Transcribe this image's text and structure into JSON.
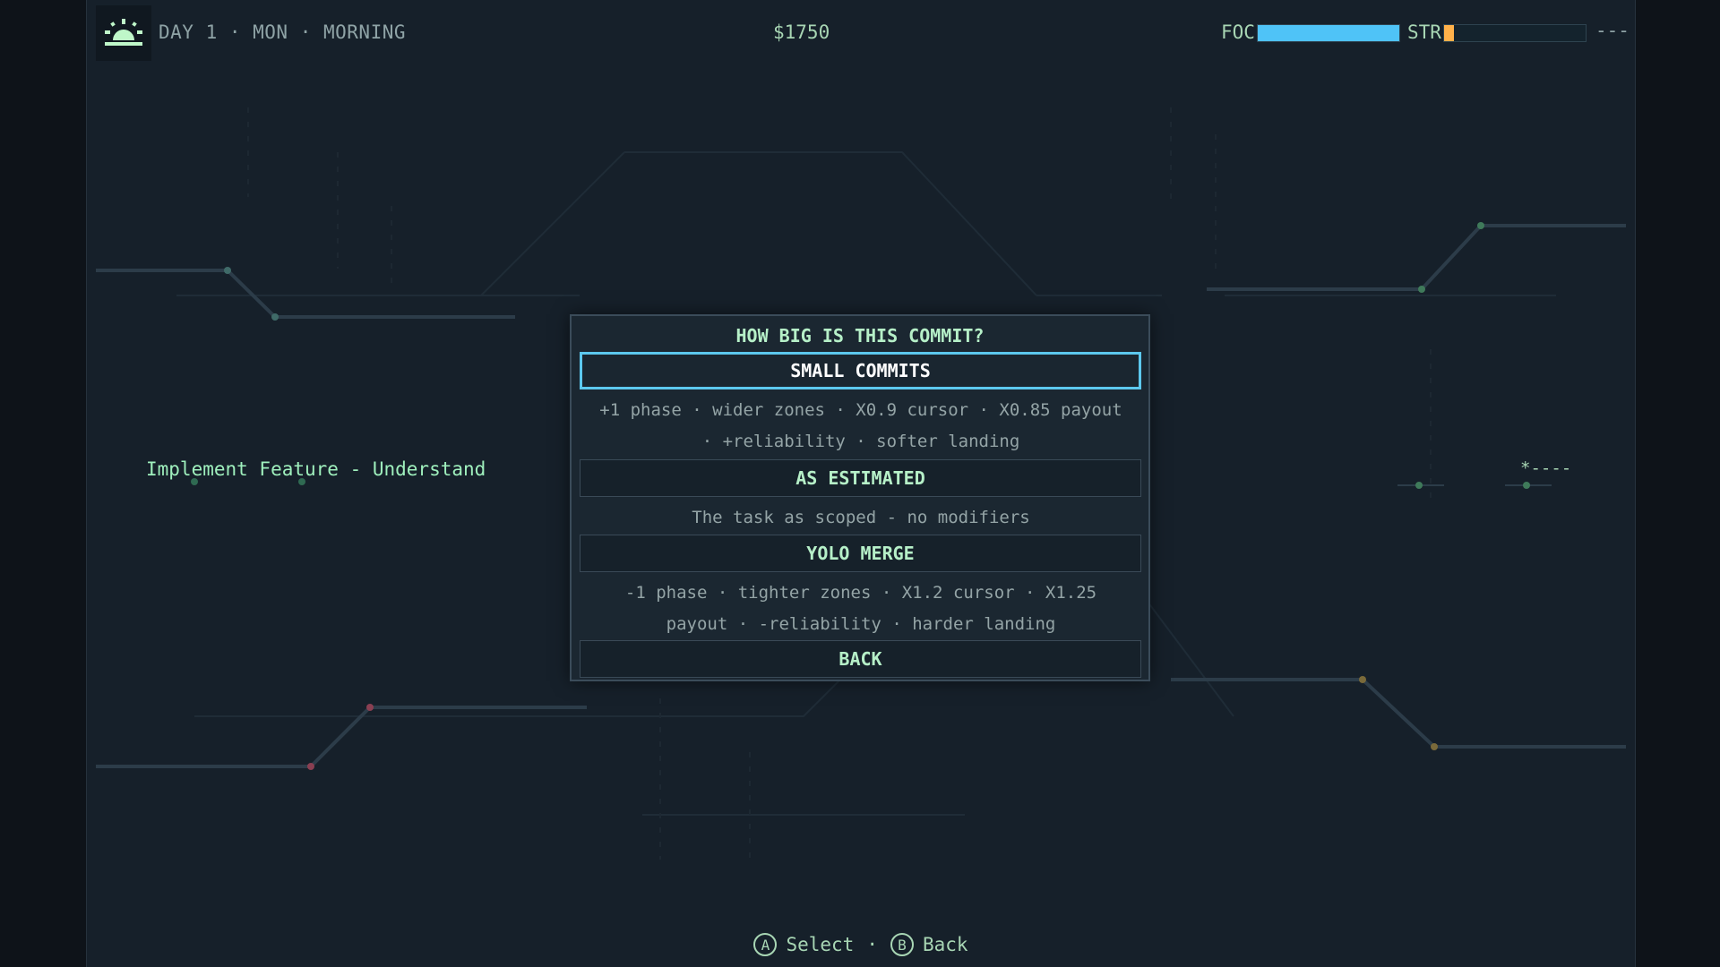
{
  "hud": {
    "time_icon": "sunrise-icon",
    "time_text": "DAY 1 · MON · MORNING",
    "money": "$1750",
    "focus": {
      "label": "FOC",
      "value": 1.0,
      "color": "#4fc3f7"
    },
    "stress": {
      "label": "STR",
      "value": 0.07,
      "color": "#ffb14a"
    },
    "extra": "---"
  },
  "task_label": "Implement Feature - Understand",
  "side_marker": "*----",
  "dialog": {
    "title": "HOW BIG IS THIS COMMIT?",
    "options": [
      {
        "label": "SMALL COMMITS",
        "selected": true,
        "desc_line1": "+1 phase · wider zones · X0.9 cursor · X0.85 payout",
        "desc_line2": "· +reliability · softer landing"
      },
      {
        "label": "AS ESTIMATED",
        "selected": false,
        "desc_line1": "The task as scoped - no modifiers"
      },
      {
        "label": "YOLO MERGE",
        "selected": false,
        "desc_line1": "-1 phase · tighter zones · X1.2 cursor · X1.25",
        "desc_line2": "payout · -reliability · harder landing"
      },
      {
        "label": "BACK",
        "selected": false
      }
    ]
  },
  "footer": {
    "select_glyph": "A",
    "select_label": "Select",
    "separator": "·",
    "back_glyph": "B",
    "back_label": "Back"
  },
  "colors": {
    "accent": "#5cc8ee",
    "text_green": "#b6f0c8",
    "background": "#16202a"
  }
}
